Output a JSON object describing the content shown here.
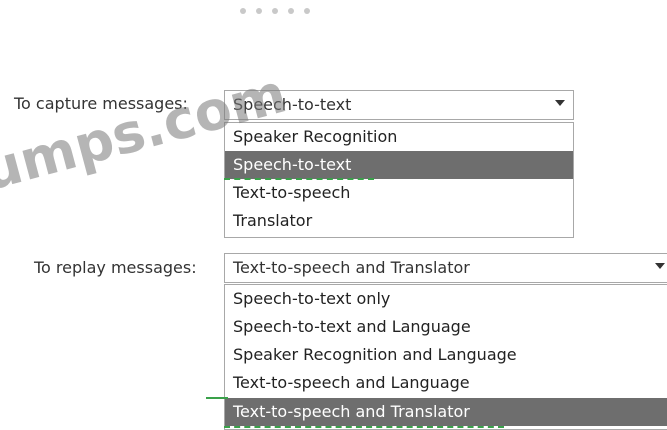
{
  "watermark_text": "umps.com",
  "capture": {
    "label": "To capture messages:",
    "selected": "Speech-to-text",
    "options": [
      "Speaker Recognition",
      "Speech-to-text",
      "Text-to-speech",
      "Translator"
    ],
    "selected_index": 1
  },
  "replay": {
    "label": "To replay messages:",
    "selected": "Text-to-speech and Translator",
    "options": [
      "Speech-to-text only",
      "Speech-to-text and Language",
      "Speaker Recognition and Language",
      "Text-to-speech and Language",
      "Text-to-speech and Translator"
    ],
    "selected_index": 4
  },
  "icons": {
    "dropdown": "chevron-down-icon"
  },
  "colors": {
    "highlight": "#6e6e6e",
    "annotation": "#3aa14a",
    "border": "#a8a8a8"
  }
}
